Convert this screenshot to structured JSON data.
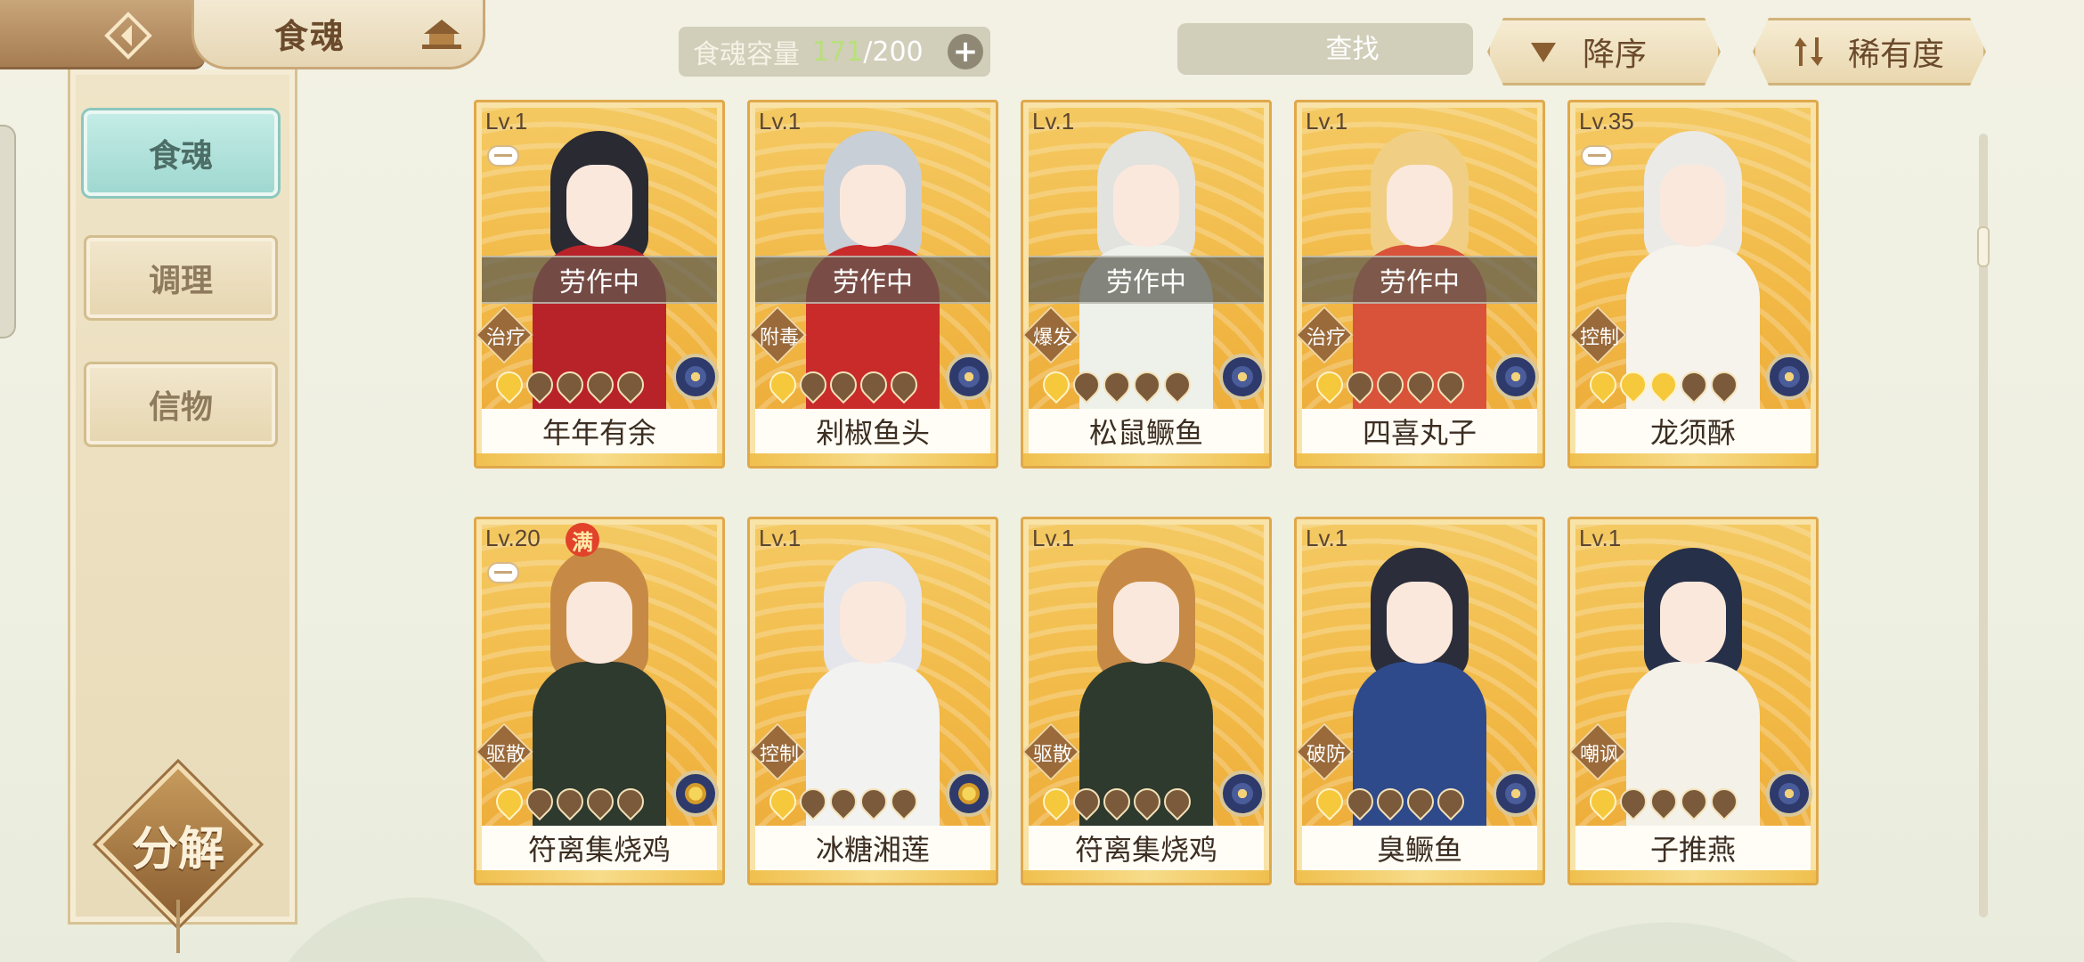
{
  "header": {
    "title": "食魂",
    "capacity_label": "食魂容量",
    "capacity_current": "171",
    "capacity_separator": "/",
    "capacity_max": "200",
    "search_placeholder": "查找",
    "clear_symbol": "✕",
    "sort_order_label": "降序",
    "sort_rarity_label": "稀有度"
  },
  "sidebar": {
    "items": [
      {
        "label": "食魂",
        "active": true
      },
      {
        "label": "调理",
        "active": false
      },
      {
        "label": "信物",
        "active": false
      }
    ],
    "decompose_label": "分解"
  },
  "working_label": "劳作中",
  "full_badge_label": "满",
  "cards": [
    {
      "level": "Lv.1",
      "name": "年年有余",
      "role": "治疗",
      "working": true,
      "stars": 1,
      "bowl": true,
      "full": false,
      "hair": "#2a2a33",
      "outfit": "#b8232a",
      "rare": "blue"
    },
    {
      "level": "Lv.1",
      "name": "剁椒鱼头",
      "role": "附毒",
      "working": true,
      "stars": 1,
      "bowl": false,
      "full": false,
      "hair": "#c9cfd6",
      "outfit": "#c92b2b",
      "rare": "blue"
    },
    {
      "level": "Lv.1",
      "name": "松鼠鳜鱼",
      "role": "爆发",
      "working": true,
      "stars": 1,
      "bowl": false,
      "full": false,
      "hair": "#e2e2de",
      "outfit": "#eef0ea",
      "rare": "blue"
    },
    {
      "level": "Lv.1",
      "name": "四喜丸子",
      "role": "治疗",
      "working": true,
      "stars": 1,
      "bowl": false,
      "full": false,
      "hair": "#f0cf85",
      "outfit": "#d9523a",
      "rare": "blue"
    },
    {
      "level": "Lv.35",
      "name": "龙须酥",
      "role": "控制",
      "working": false,
      "stars": 3,
      "bowl": true,
      "full": false,
      "hair": "#eceae6",
      "outfit": "#f6f3ec",
      "rare": "blue"
    },
    {
      "level": "Lv.20",
      "name": "符离集烧鸡",
      "role": "驱散",
      "working": false,
      "stars": 1,
      "bowl": true,
      "full": true,
      "hair": "#c78a46",
      "outfit": "#2f3a2e",
      "rare": "gold"
    },
    {
      "level": "Lv.1",
      "name": "冰糖湘莲",
      "role": "控制",
      "working": false,
      "stars": 1,
      "bowl": false,
      "full": false,
      "hair": "#e4e6ec",
      "outfit": "#f2f2f0",
      "rare": "gold"
    },
    {
      "level": "Lv.1",
      "name": "符离集烧鸡",
      "role": "驱散",
      "working": false,
      "stars": 1,
      "bowl": false,
      "full": false,
      "hair": "#c78a46",
      "outfit": "#2f3a2e",
      "rare": "blue"
    },
    {
      "level": "Lv.1",
      "name": "臭鳜鱼",
      "role": "破防",
      "working": false,
      "stars": 1,
      "bowl": false,
      "full": false,
      "hair": "#2b2e3a",
      "outfit": "#2f4a8a",
      "rare": "blue"
    },
    {
      "level": "Lv.1",
      "name": "子推燕",
      "role": "嘲讽",
      "working": false,
      "stars": 1,
      "bowl": false,
      "full": false,
      "hair": "#263048",
      "outfit": "#f4f1e8",
      "rare": "blue"
    }
  ],
  "colors": {
    "card_border": "#e0a84a",
    "card_bg": "#f2b946",
    "active_tab": "#9fd8d0",
    "capacity_current_color": "#b8e07a"
  }
}
